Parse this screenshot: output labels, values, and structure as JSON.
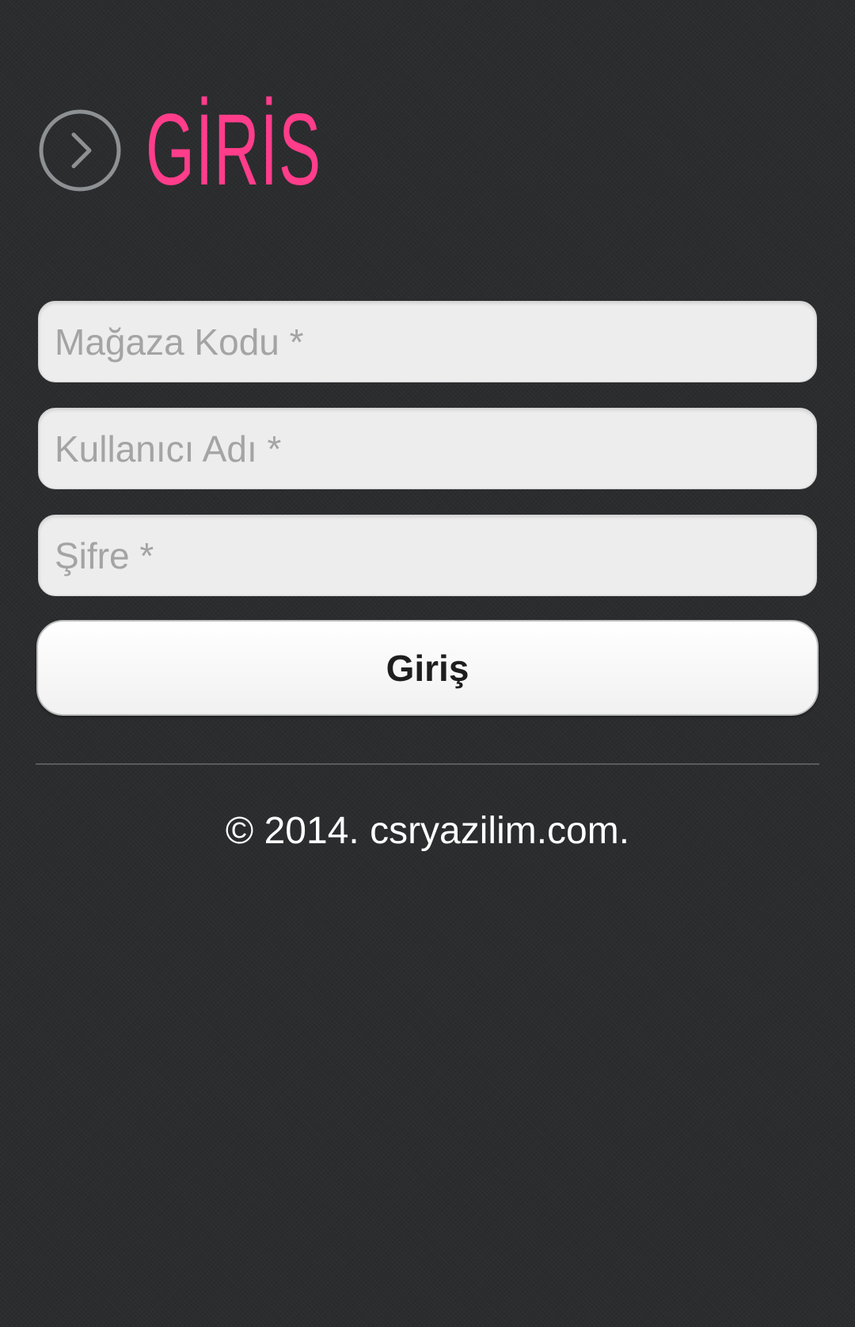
{
  "header": {
    "title": "GİRİS",
    "icon": "chevron-right-circle-icon",
    "title_color": "#ff3d8b",
    "icon_color": "#8d9194"
  },
  "form": {
    "store_code_placeholder": "Mağaza Kodu *",
    "username_placeholder": "Kullanıcı Adı *",
    "password_placeholder": "Şifre *",
    "submit_label": "Giriş"
  },
  "footer": {
    "copyright": "© 2014. csryazilim.com."
  }
}
